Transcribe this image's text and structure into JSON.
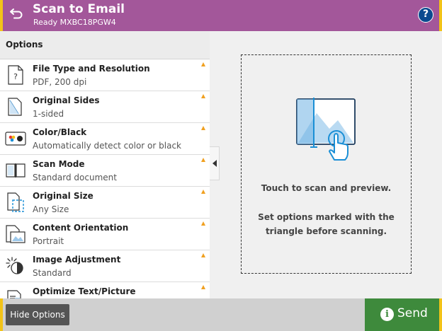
{
  "header": {
    "title": "Scan to Email",
    "subtitle": "Ready MXBC18PGW4",
    "help_label": "?",
    "back_icon": "back-arrow-icon"
  },
  "options": {
    "header": "Options",
    "items": [
      {
        "label": "File Type and Resolution",
        "value": "PDF, 200 dpi",
        "icon": "file-type-icon",
        "flag": "triangle"
      },
      {
        "label": "Original Sides",
        "value": "1-sided",
        "icon": "original-sides-icon",
        "flag": "triangle"
      },
      {
        "label": "Color/Black",
        "value": "Automatically detect color or black",
        "icon": "color-black-icon",
        "flag": "triangle"
      },
      {
        "label": "Scan Mode",
        "value": "Standard document",
        "icon": "scan-mode-icon",
        "flag": "triangle"
      },
      {
        "label": "Original Size",
        "value": "Any Size",
        "icon": "original-size-icon",
        "flag": "triangle"
      },
      {
        "label": "Content Orientation",
        "value": "Portrait",
        "icon": "content-orientation-icon",
        "flag": "triangle"
      },
      {
        "label": "Image Adjustment",
        "value": "Standard",
        "icon": "image-adjustment-icon",
        "flag": "triangle"
      },
      {
        "label": "Optimize Text/Picture",
        "value": "",
        "icon": "optimize-text-picture-icon",
        "flag": "triangle"
      }
    ]
  },
  "preview": {
    "line1": "Touch to scan and preview.",
    "line2a": "Set options marked with the",
    "line2b": "triangle before scanning."
  },
  "bottom": {
    "hide_label": "Hide Options",
    "send_label": "Send",
    "info_label": "i"
  },
  "colors": {
    "header": "#a3579a",
    "accent": "#f2c318",
    "send": "#3e8a3c",
    "triangle": "#f0a020",
    "help": "#0b4a8f"
  }
}
